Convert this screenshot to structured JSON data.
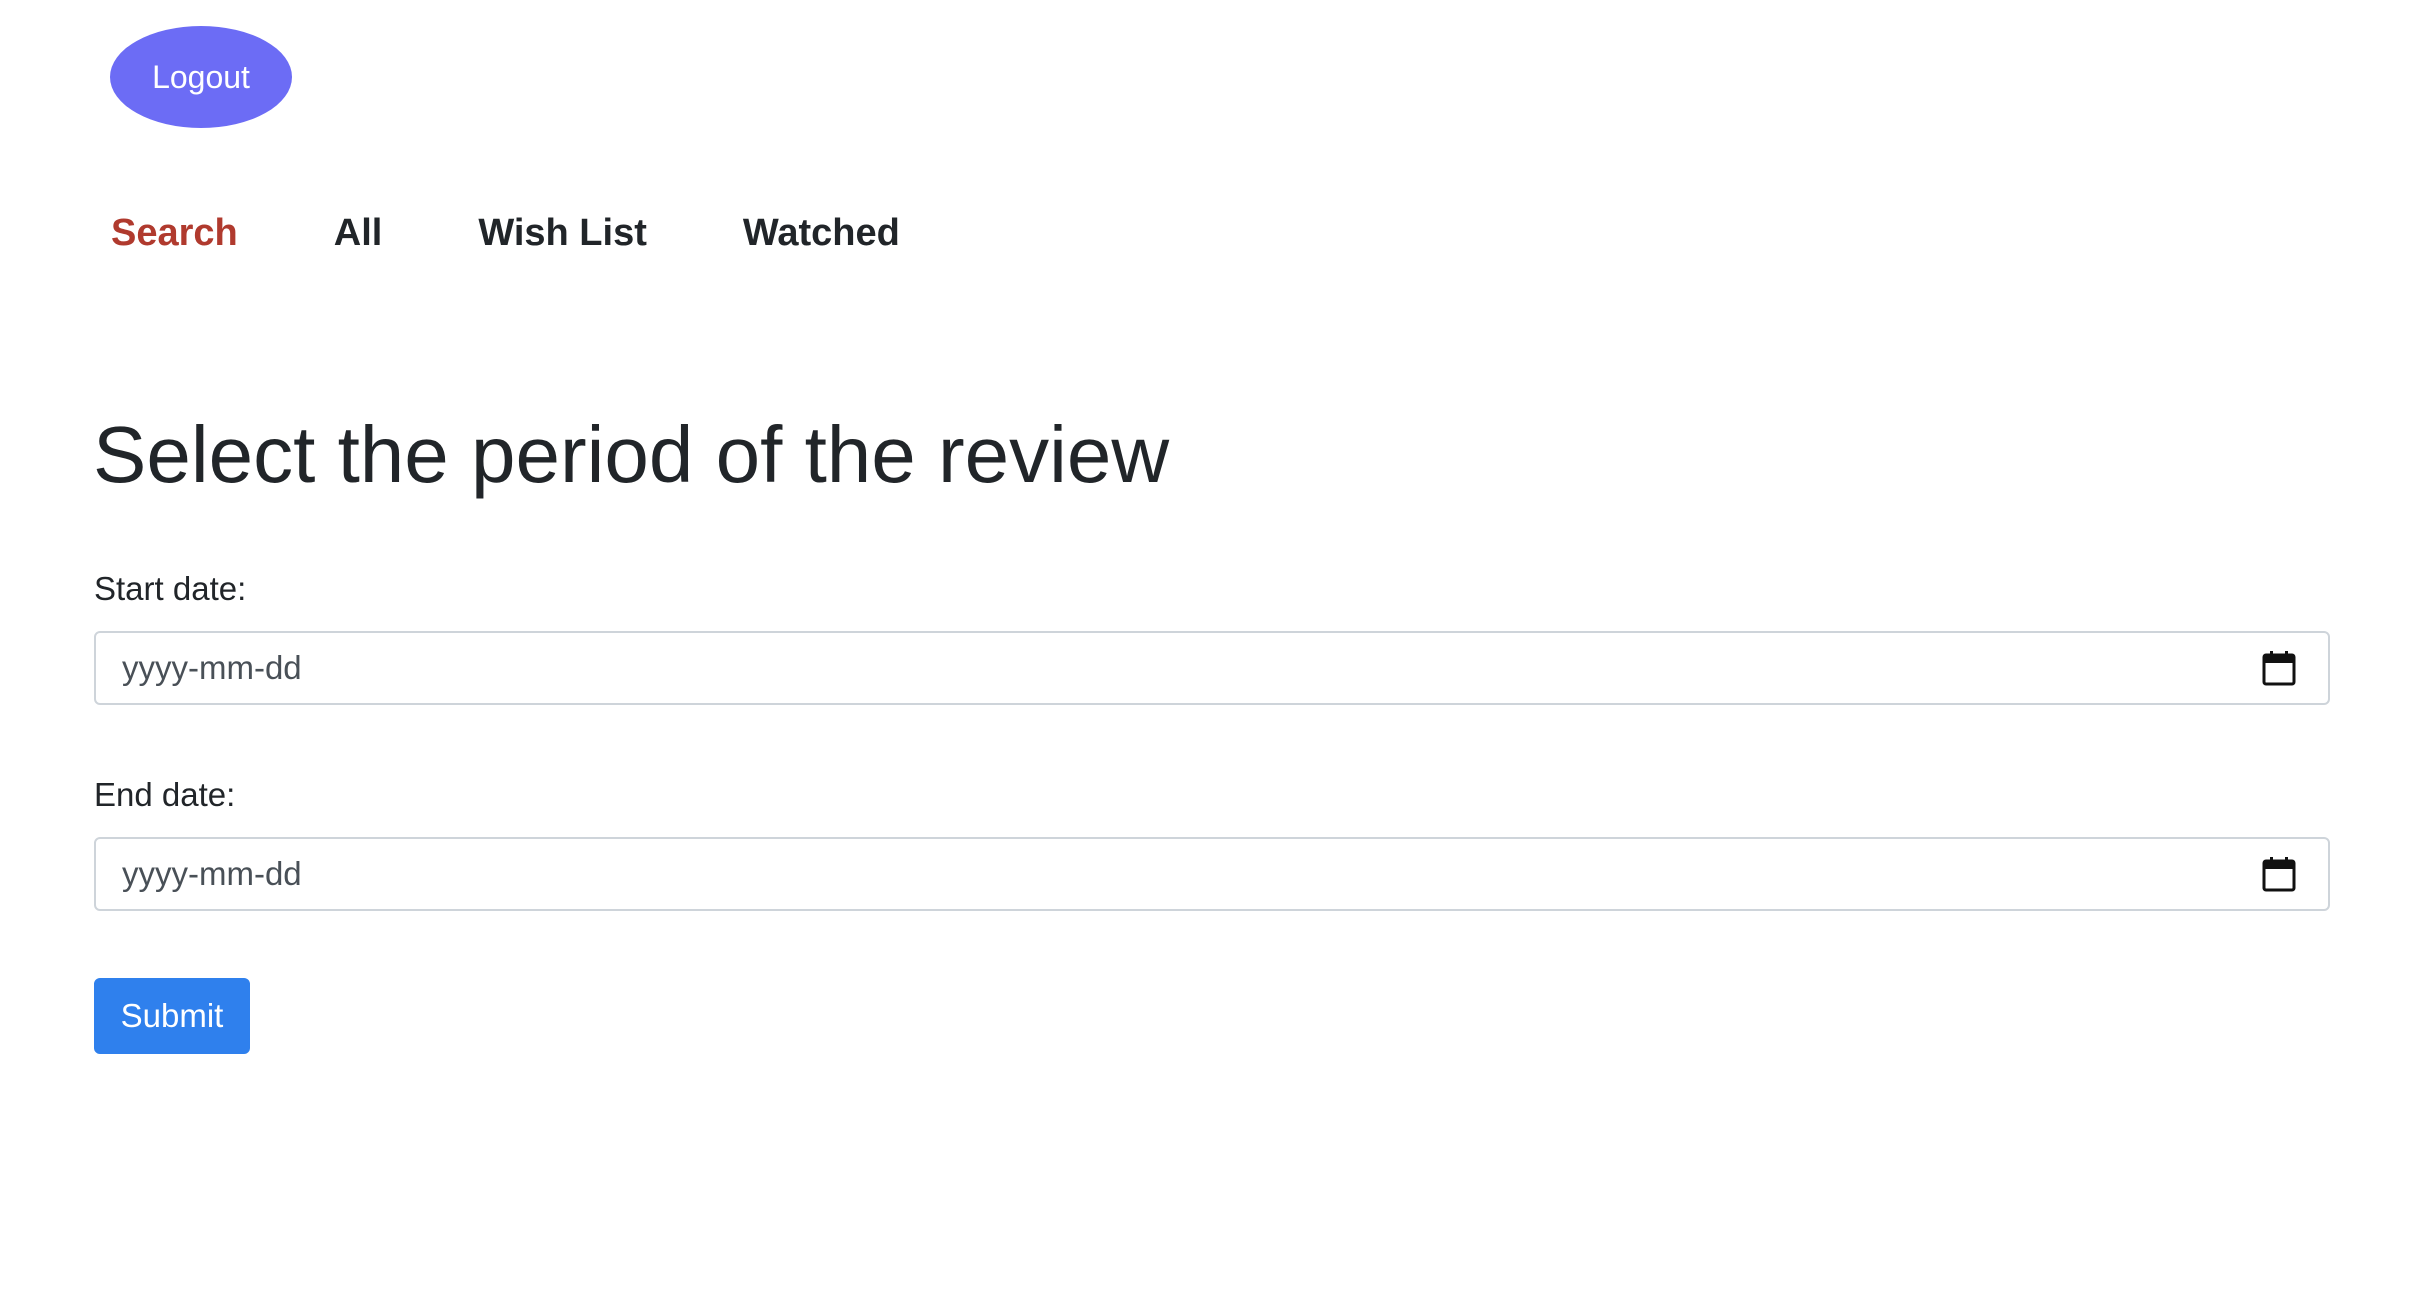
{
  "header": {
    "logout_label": "Logout"
  },
  "nav": {
    "items": [
      {
        "label": "Search",
        "active": true
      },
      {
        "label": "All",
        "active": false
      },
      {
        "label": "Wish List",
        "active": false
      },
      {
        "label": "Watched",
        "active": false
      }
    ]
  },
  "form": {
    "title": "Select the period of the review",
    "start": {
      "label": "Start date:",
      "value": "",
      "placeholder": "yyyy-mm-dd",
      "icon": "calendar-icon"
    },
    "end": {
      "label": "End date:",
      "value": "",
      "placeholder": "yyyy-mm-dd",
      "icon": "calendar-icon"
    },
    "submit_label": "Submit"
  },
  "colors": {
    "logout_bg": "#6c6cf5",
    "nav_active": "#b03a2e",
    "submit_bg": "#2f80ed",
    "text": "#212529"
  }
}
